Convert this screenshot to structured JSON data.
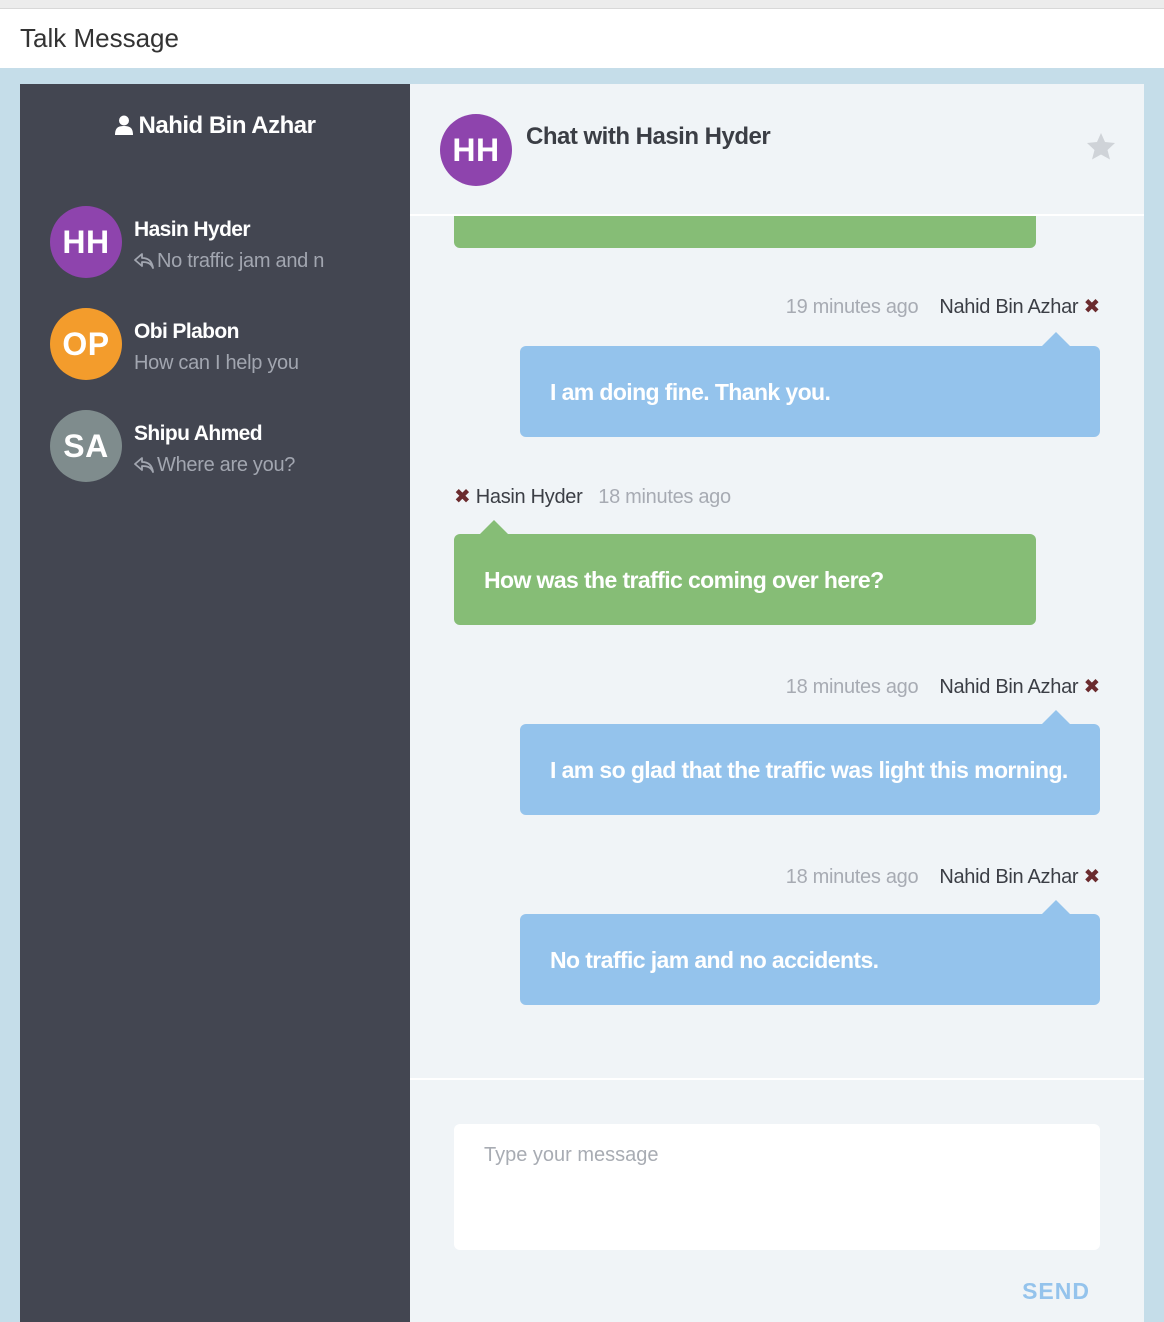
{
  "app": {
    "title": "Talk Message"
  },
  "current_user": {
    "name": "Nahid Bin Azhar",
    "icon": "user-icon"
  },
  "contacts": [
    {
      "initials": "HH",
      "name": "Hasin Hyder",
      "preview": "No traffic jam and n",
      "color": "#8e44ad",
      "reply_icon": true
    },
    {
      "initials": "OP",
      "name": "Obi Plabon",
      "preview": "How can I help you",
      "color": "#f39c2c",
      "reply_icon": false
    },
    {
      "initials": "SA",
      "name": "Shipu Ahmed",
      "preview": "Where are you?",
      "color": "#7f8c8d",
      "reply_icon": true
    }
  ],
  "chat": {
    "avatar_initials": "HH",
    "avatar_color": "#8e44ad",
    "title": "Chat with Hasin Hyder",
    "star_icon": "star-icon"
  },
  "messages": [
    {
      "time": "19 minutes ago",
      "sender": "Nahid Bin Azhar",
      "text": "I am doing fine. Thank you.",
      "direction": "out"
    },
    {
      "time": "18 minutes ago",
      "sender": "Hasin Hyder",
      "text": "How was the traffic coming over here?",
      "direction": "in"
    },
    {
      "time": "18 minutes ago",
      "sender": "Nahid Bin Azhar",
      "text": "I am so glad that the traffic was light this morning.",
      "direction": "out"
    },
    {
      "time": "18 minutes ago",
      "sender": "Nahid Bin Azhar",
      "text": "No traffic jam and no accidents.",
      "direction": "out"
    }
  ],
  "composer": {
    "placeholder": "Type your message",
    "send_label": "SEND"
  },
  "colors": {
    "sidebar": "#434651",
    "incoming": "#86bd76",
    "outgoing": "#94c3ec",
    "background": "#c5dde9"
  }
}
